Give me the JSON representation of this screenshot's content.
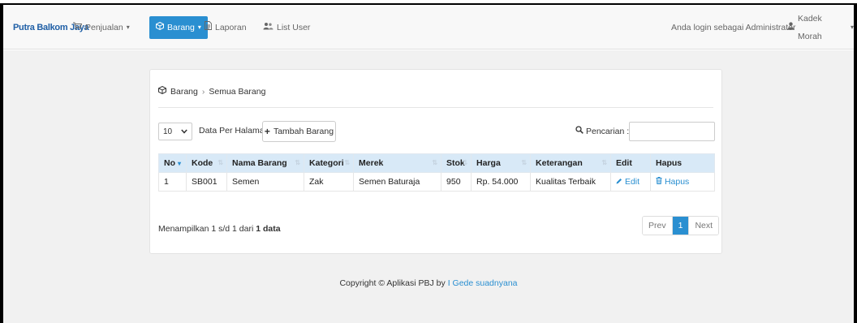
{
  "navbar": {
    "brand": "Putra Balkom Jaya",
    "items": [
      {
        "label": "Penjualan",
        "icon": "cart-icon",
        "dropdown": true,
        "active": false
      },
      {
        "label": "Barang",
        "icon": "box-icon",
        "dropdown": true,
        "active": true
      },
      {
        "label": "Laporan",
        "icon": "document-icon",
        "dropdown": false,
        "active": false
      },
      {
        "label": "List User",
        "icon": "users-icon",
        "dropdown": false,
        "active": false
      }
    ],
    "login_text": "Anda login sebagai Administrator",
    "user_name": "Kadek Morah"
  },
  "breadcrumb": {
    "root": "Barang",
    "separator": "›",
    "current": "Semua Barang"
  },
  "controls": {
    "per_page_value": "10",
    "per_page_label": "Data Per Halaman",
    "add_button_label": "Tambah Barang",
    "search_label": "Pencarian :",
    "search_value": ""
  },
  "table": {
    "headers": [
      "No",
      "Kode",
      "Nama Barang",
      "Kategori",
      "Merek",
      "Stok",
      "Harga",
      "Keterangan",
      "Edit",
      "Hapus"
    ],
    "rows": [
      {
        "no": "1",
        "kode": "SB001",
        "nama": "Semen",
        "kategori": "Zak",
        "merek": "Semen Baturaja",
        "stok": "950",
        "harga": "Rp. 54.000",
        "keterangan": "Kualitas Terbaik",
        "edit": "Edit",
        "hapus": "Hapus"
      }
    ]
  },
  "info": {
    "prefix": "Menampilkan 1 s/d 1 dari",
    "total": "1",
    "suffix": "data"
  },
  "pagination": {
    "prev": "Prev",
    "current": "1",
    "next": "Next"
  },
  "footer": {
    "text": "Copyright © Aplikasi PBJ by",
    "author": "I Gede suadnyana"
  },
  "colors": {
    "accent": "#2a8fd1",
    "header_bg": "#d8e9f7",
    "brand": "#1f5fa6"
  }
}
